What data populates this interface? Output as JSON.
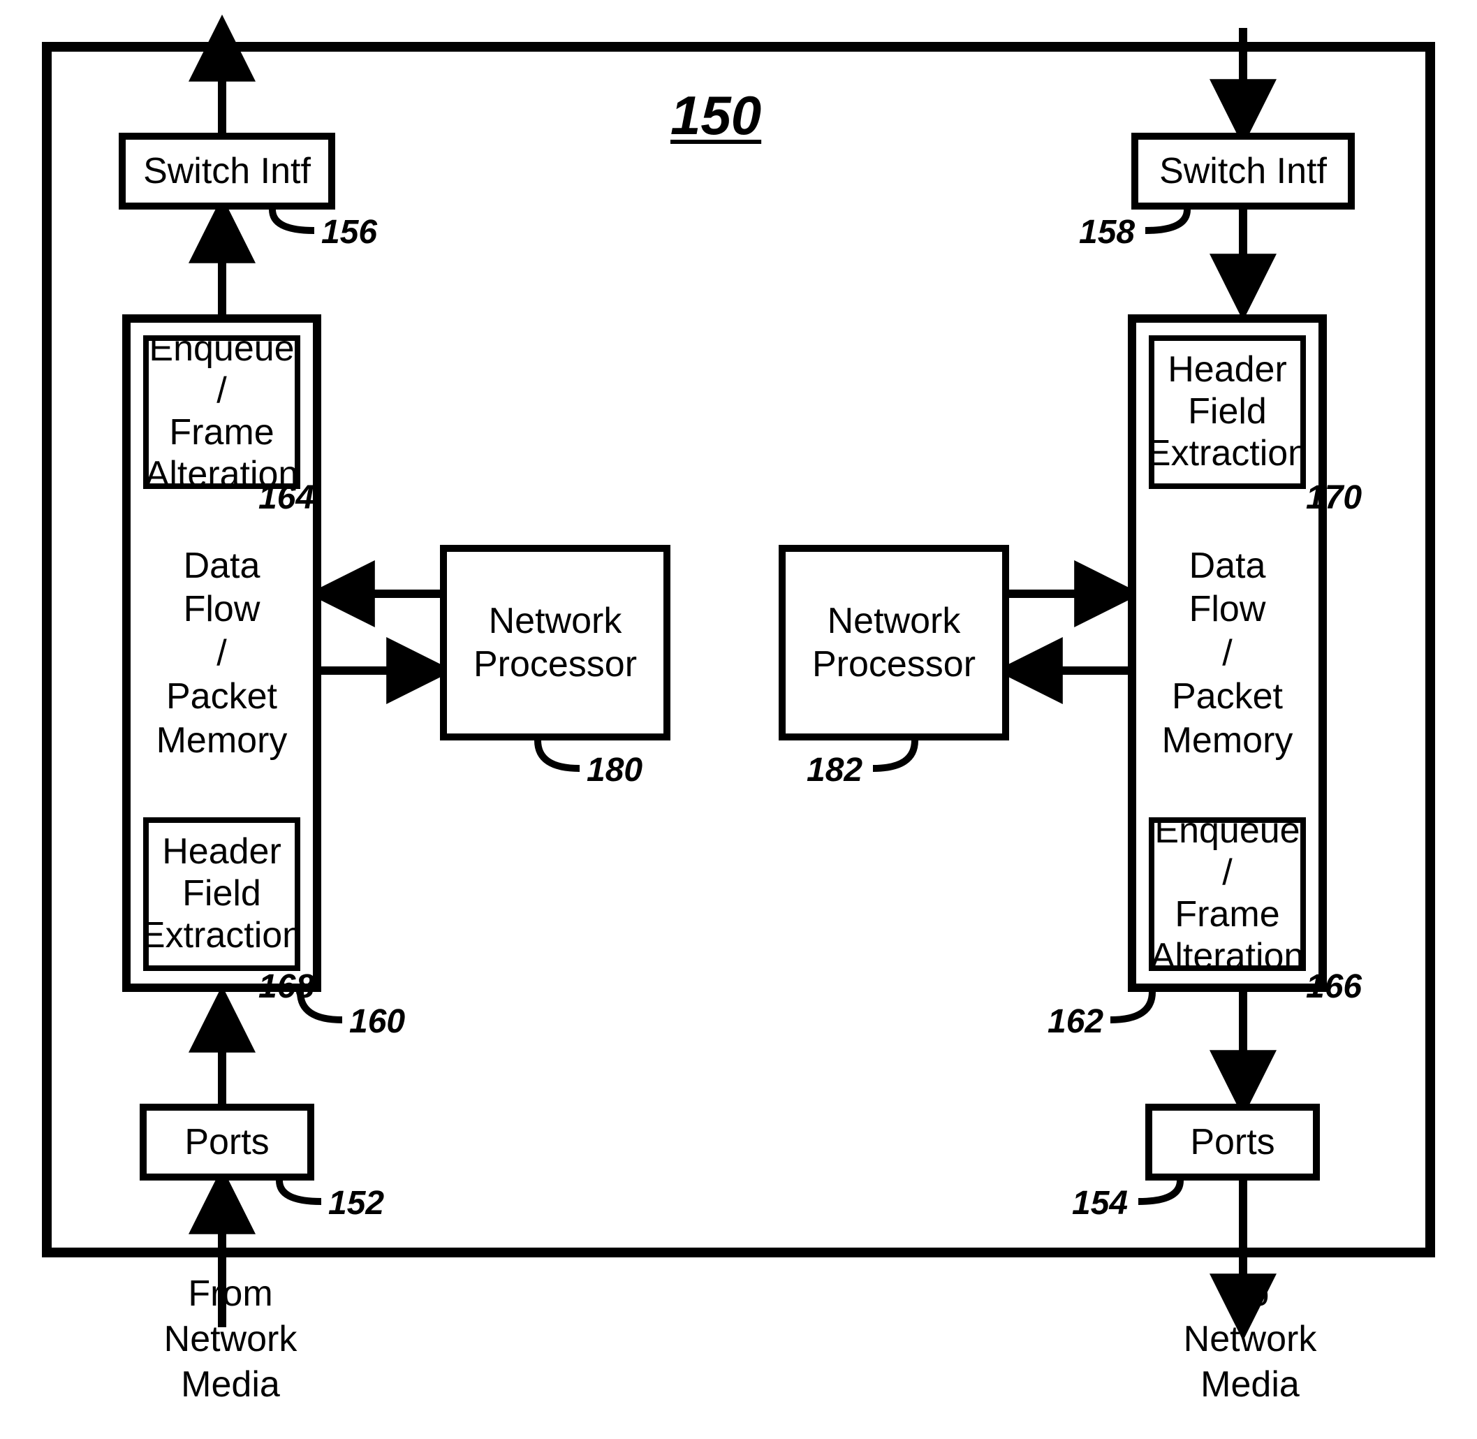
{
  "title": "150",
  "left": {
    "switch_intf": "Switch Intf",
    "switch_intf_ref": "156",
    "dataflow_ref": "160",
    "enqueue_frame_alteration": "Enqueue /\nFrame\nAlteration",
    "enqueue_frame_alteration_ref": "164",
    "data_flow_packet_memory": "Data\nFlow\n/\nPacket\nMemory",
    "header_field_extraction": "Header\nField\nExtraction",
    "header_field_extraction_ref": "168",
    "ports": "Ports",
    "ports_ref": "152",
    "network_processor": "Network\nProcessor",
    "network_processor_ref": "180",
    "io_label": "From\nNetwork\nMedia"
  },
  "right": {
    "switch_intf": "Switch Intf",
    "switch_intf_ref": "158",
    "dataflow_ref": "162",
    "header_field_extraction": "Header\nField\nExtraction",
    "header_field_extraction_ref": "170",
    "data_flow_packet_memory": "Data\nFlow\n/\nPacket\nMemory",
    "enqueue_frame_alteration": "Enqueue /\nFrame\nAlteration",
    "enqueue_frame_alteration_ref": "166",
    "ports": "Ports",
    "ports_ref": "154",
    "network_processor": "Network\nProcessor",
    "network_processor_ref": "182",
    "io_label": "To\nNetwork\nMedia"
  }
}
